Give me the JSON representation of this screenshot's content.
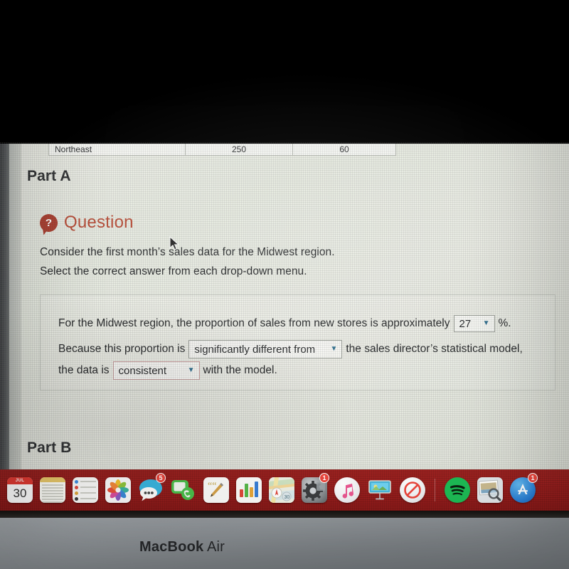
{
  "screen": {
    "table_fragment": {
      "row_label": "Northeast",
      "col2": "250",
      "col3": "60"
    },
    "part_a_heading": "Part A",
    "part_b_heading": "Part B",
    "question_badge_glyph": "?",
    "question_label": "Question",
    "question_lines": [
      "Consider the first month’s sales data for the Midwest region.",
      "Select the correct answer from each drop-down menu."
    ],
    "answer_box": {
      "line1_before": "For the Midwest region, the proportion of sales from new stores is approximately",
      "dropdown_percent_value": "27",
      "line1_after": "%.",
      "line2_before": "Because this proportion is",
      "dropdown_compare_value": "significantly different from",
      "line2_after": "the sales director’s statistical model,",
      "line3_before": "the data is",
      "dropdown_consistent_value": "consistent",
      "line3_after": "with the model.",
      "caret_glyph": "▼"
    },
    "colors": {
      "question_red": "#b6452f",
      "badge_red": "#a8392a",
      "caret_blue": "#2a6b8c",
      "dropdown_border": "#9b9f98",
      "dropdown_border_rose": "#c89d9d"
    }
  },
  "dock": {
    "background_color": "#9a1f1e",
    "items": [
      {
        "name": "calendar-icon",
        "label": "Calendar",
        "month": "JUL",
        "day": "30",
        "badge": ""
      },
      {
        "name": "notes-icon",
        "label": "Notes",
        "badge": ""
      },
      {
        "name": "reminders-icon",
        "label": "Reminders",
        "badge": ""
      },
      {
        "name": "photos-icon",
        "label": "Photos",
        "badge": ""
      },
      {
        "name": "messages-icon",
        "label": "Messages",
        "badge": "5"
      },
      {
        "name": "facetime-icon",
        "label": "FaceTime",
        "badge": ""
      },
      {
        "name": "pages-icon",
        "label": "Pages",
        "badge": ""
      },
      {
        "name": "numbers-icon",
        "label": "Numbers",
        "badge": ""
      },
      {
        "name": "maps-icon",
        "label": "Maps",
        "badge": ""
      },
      {
        "name": "system-preferences-icon",
        "label": "System Preferences",
        "badge": "1"
      },
      {
        "name": "itunes-icon",
        "label": "iTunes",
        "badge": ""
      },
      {
        "name": "keynote-icon",
        "label": "Keynote",
        "badge": ""
      },
      {
        "name": "no-entry-icon",
        "label": "Blocked App",
        "badge": ""
      },
      {
        "name": "spotify-icon",
        "label": "Spotify",
        "badge": ""
      },
      {
        "name": "preview-icon",
        "label": "Preview",
        "badge": ""
      },
      {
        "name": "app-store-icon",
        "label": "App Store",
        "badge": "1"
      }
    ],
    "separator_after_index": 12
  },
  "laptop": {
    "brand_bold": "MacBook",
    "brand_light": " Air"
  }
}
